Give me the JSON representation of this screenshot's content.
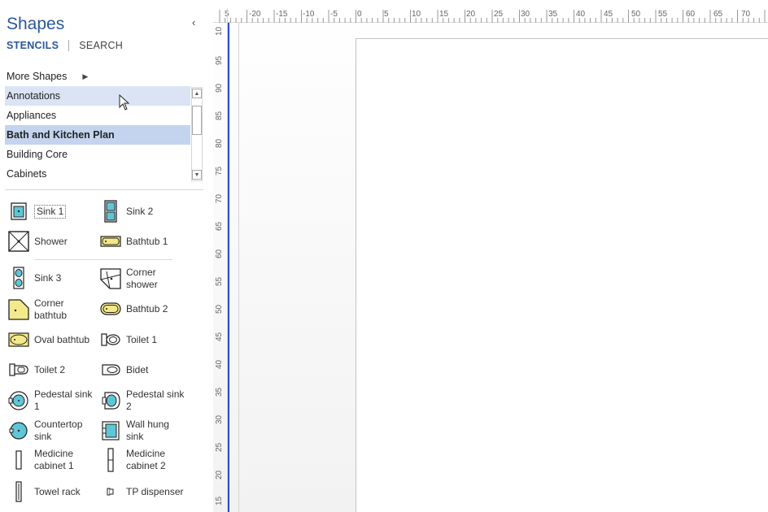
{
  "pane": {
    "title": "Shapes",
    "collapse_glyph": "‹",
    "tabs": {
      "stencils": "STENCILS",
      "search": "SEARCH"
    },
    "more_shapes": "More Shapes"
  },
  "stencils": [
    {
      "label": "Annotations",
      "state": "hover"
    },
    {
      "label": "Appliances",
      "state": "normal"
    },
    {
      "label": "Bath and Kitchen Plan",
      "state": "selected"
    },
    {
      "label": "Building Core",
      "state": "normal"
    },
    {
      "label": "Cabinets",
      "state": "normal"
    }
  ],
  "shapes": [
    {
      "label": "Sink 1",
      "icon": "sink-1-icon"
    },
    {
      "label": "Sink 2",
      "icon": "sink-2-icon"
    },
    {
      "label": "Shower",
      "icon": "shower-icon"
    },
    {
      "label": "Bathtub 1",
      "icon": "bathtub-1-icon"
    },
    {
      "label": "Sink 3",
      "icon": "sink-3-icon"
    },
    {
      "label": "Corner shower",
      "icon": "corner-shower-icon"
    },
    {
      "label": "Corner bathtub",
      "icon": "corner-bathtub-icon"
    },
    {
      "label": "Bathtub 2",
      "icon": "bathtub-2-icon"
    },
    {
      "label": "Oval bathtub",
      "icon": "oval-bathtub-icon"
    },
    {
      "label": "Toilet 1",
      "icon": "toilet-1-icon"
    },
    {
      "label": "Toilet 2",
      "icon": "toilet-2-icon"
    },
    {
      "label": "Bidet",
      "icon": "bidet-icon"
    },
    {
      "label": "Pedestal sink 1",
      "icon": "pedestal-sink-1-icon"
    },
    {
      "label": "Pedestal sink 2",
      "icon": "pedestal-sink-2-icon"
    },
    {
      "label": "Countertop sink",
      "icon": "countertop-sink-icon"
    },
    {
      "label": "Wall hung sink",
      "icon": "wall-hung-sink-icon"
    },
    {
      "label": "Medicine cabinet 1",
      "icon": "medicine-cabinet-1-icon"
    },
    {
      "label": "Medicine cabinet 2",
      "icon": "medicine-cabinet-2-icon"
    },
    {
      "label": "Towel rack",
      "icon": "towel-rack-icon"
    },
    {
      "label": "TP dispenser",
      "icon": "tp-dispenser-icon"
    }
  ],
  "rulers": {
    "horizontal": [
      "5",
      "-20",
      "-15",
      "-10",
      "-5",
      "0",
      "5",
      "10",
      "15",
      "20",
      "25",
      "30",
      "35",
      "40",
      "45",
      "50",
      "55",
      "60",
      "65",
      "70"
    ],
    "vertical": [
      "10",
      "95",
      "90",
      "85",
      "80",
      "75",
      "70",
      "65",
      "60",
      "55",
      "50",
      "45",
      "40",
      "35",
      "30",
      "25",
      "20",
      "15"
    ]
  },
  "colors": {
    "accent": "#2b579a",
    "fixture_fill": "#f3e98a",
    "sink_fill": "#5fc6d8",
    "guide": "#2b4bd0"
  }
}
